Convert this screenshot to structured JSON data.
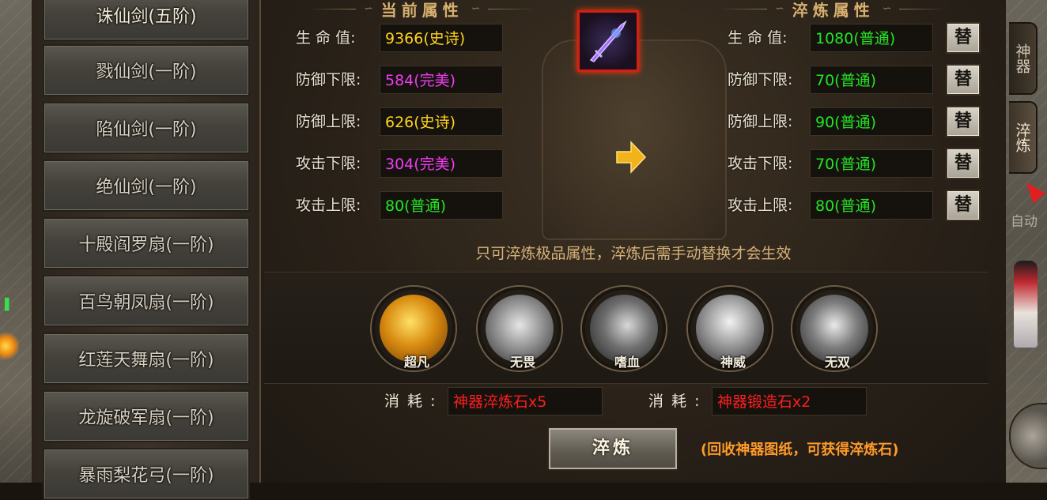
{
  "weapon_list": [
    "诛仙剑(五阶)",
    "戮仙剑(一阶)",
    "陷仙剑(一阶)",
    "绝仙剑(一阶)",
    "十殿阎罗扇(一阶)",
    "百鸟朝凤扇(一阶)",
    "红莲天舞扇(一阶)",
    "龙旋破军扇(一阶)",
    "暴雨梨花弓(一阶)"
  ],
  "current": {
    "title": "当前属性",
    "stats": [
      {
        "label": "生 命 值:",
        "value": "9366(史诗)"
      },
      {
        "label": "防御下限:",
        "value": "584(完美)"
      },
      {
        "label": "防御上限:",
        "value": "626(史诗)"
      },
      {
        "label": "攻击下限:",
        "value": "304(完美)"
      },
      {
        "label": "攻击上限:",
        "value": "80(普通)"
      }
    ]
  },
  "refined": {
    "title": "淬炼属性",
    "replace_label": "替",
    "stats": [
      {
        "label": "生 命 值:",
        "value": "1080(普通)"
      },
      {
        "label": "防御下限:",
        "value": "70(普通)"
      },
      {
        "label": "防御上限:",
        "value": "90(普通)"
      },
      {
        "label": "攻击下限:",
        "value": "70(普通)"
      },
      {
        "label": "攻击上限:",
        "value": "80(普通)"
      }
    ]
  },
  "quality_colors": {
    "史诗": "#ffd21e",
    "完美": "#f03cf0",
    "普通": "#24e424"
  },
  "hint": "只可淬炼极品属性，淬炼后需手动替换才会生效",
  "skills": [
    "超凡",
    "无畏",
    "嗜血",
    "神威",
    "无双"
  ],
  "cost": [
    {
      "label": "消 耗 :",
      "value": "神器淬炼石x5"
    },
    {
      "label": "消 耗 :",
      "value": "神器锻造石x2"
    }
  ],
  "refine_button": "淬炼",
  "recycle_note": "(回收神器图纸，可获得淬炼石)",
  "side_tabs": [
    {
      "label": "神器",
      "active": false
    },
    {
      "label": "淬炼",
      "active": true
    }
  ],
  "auto_label": "自动"
}
